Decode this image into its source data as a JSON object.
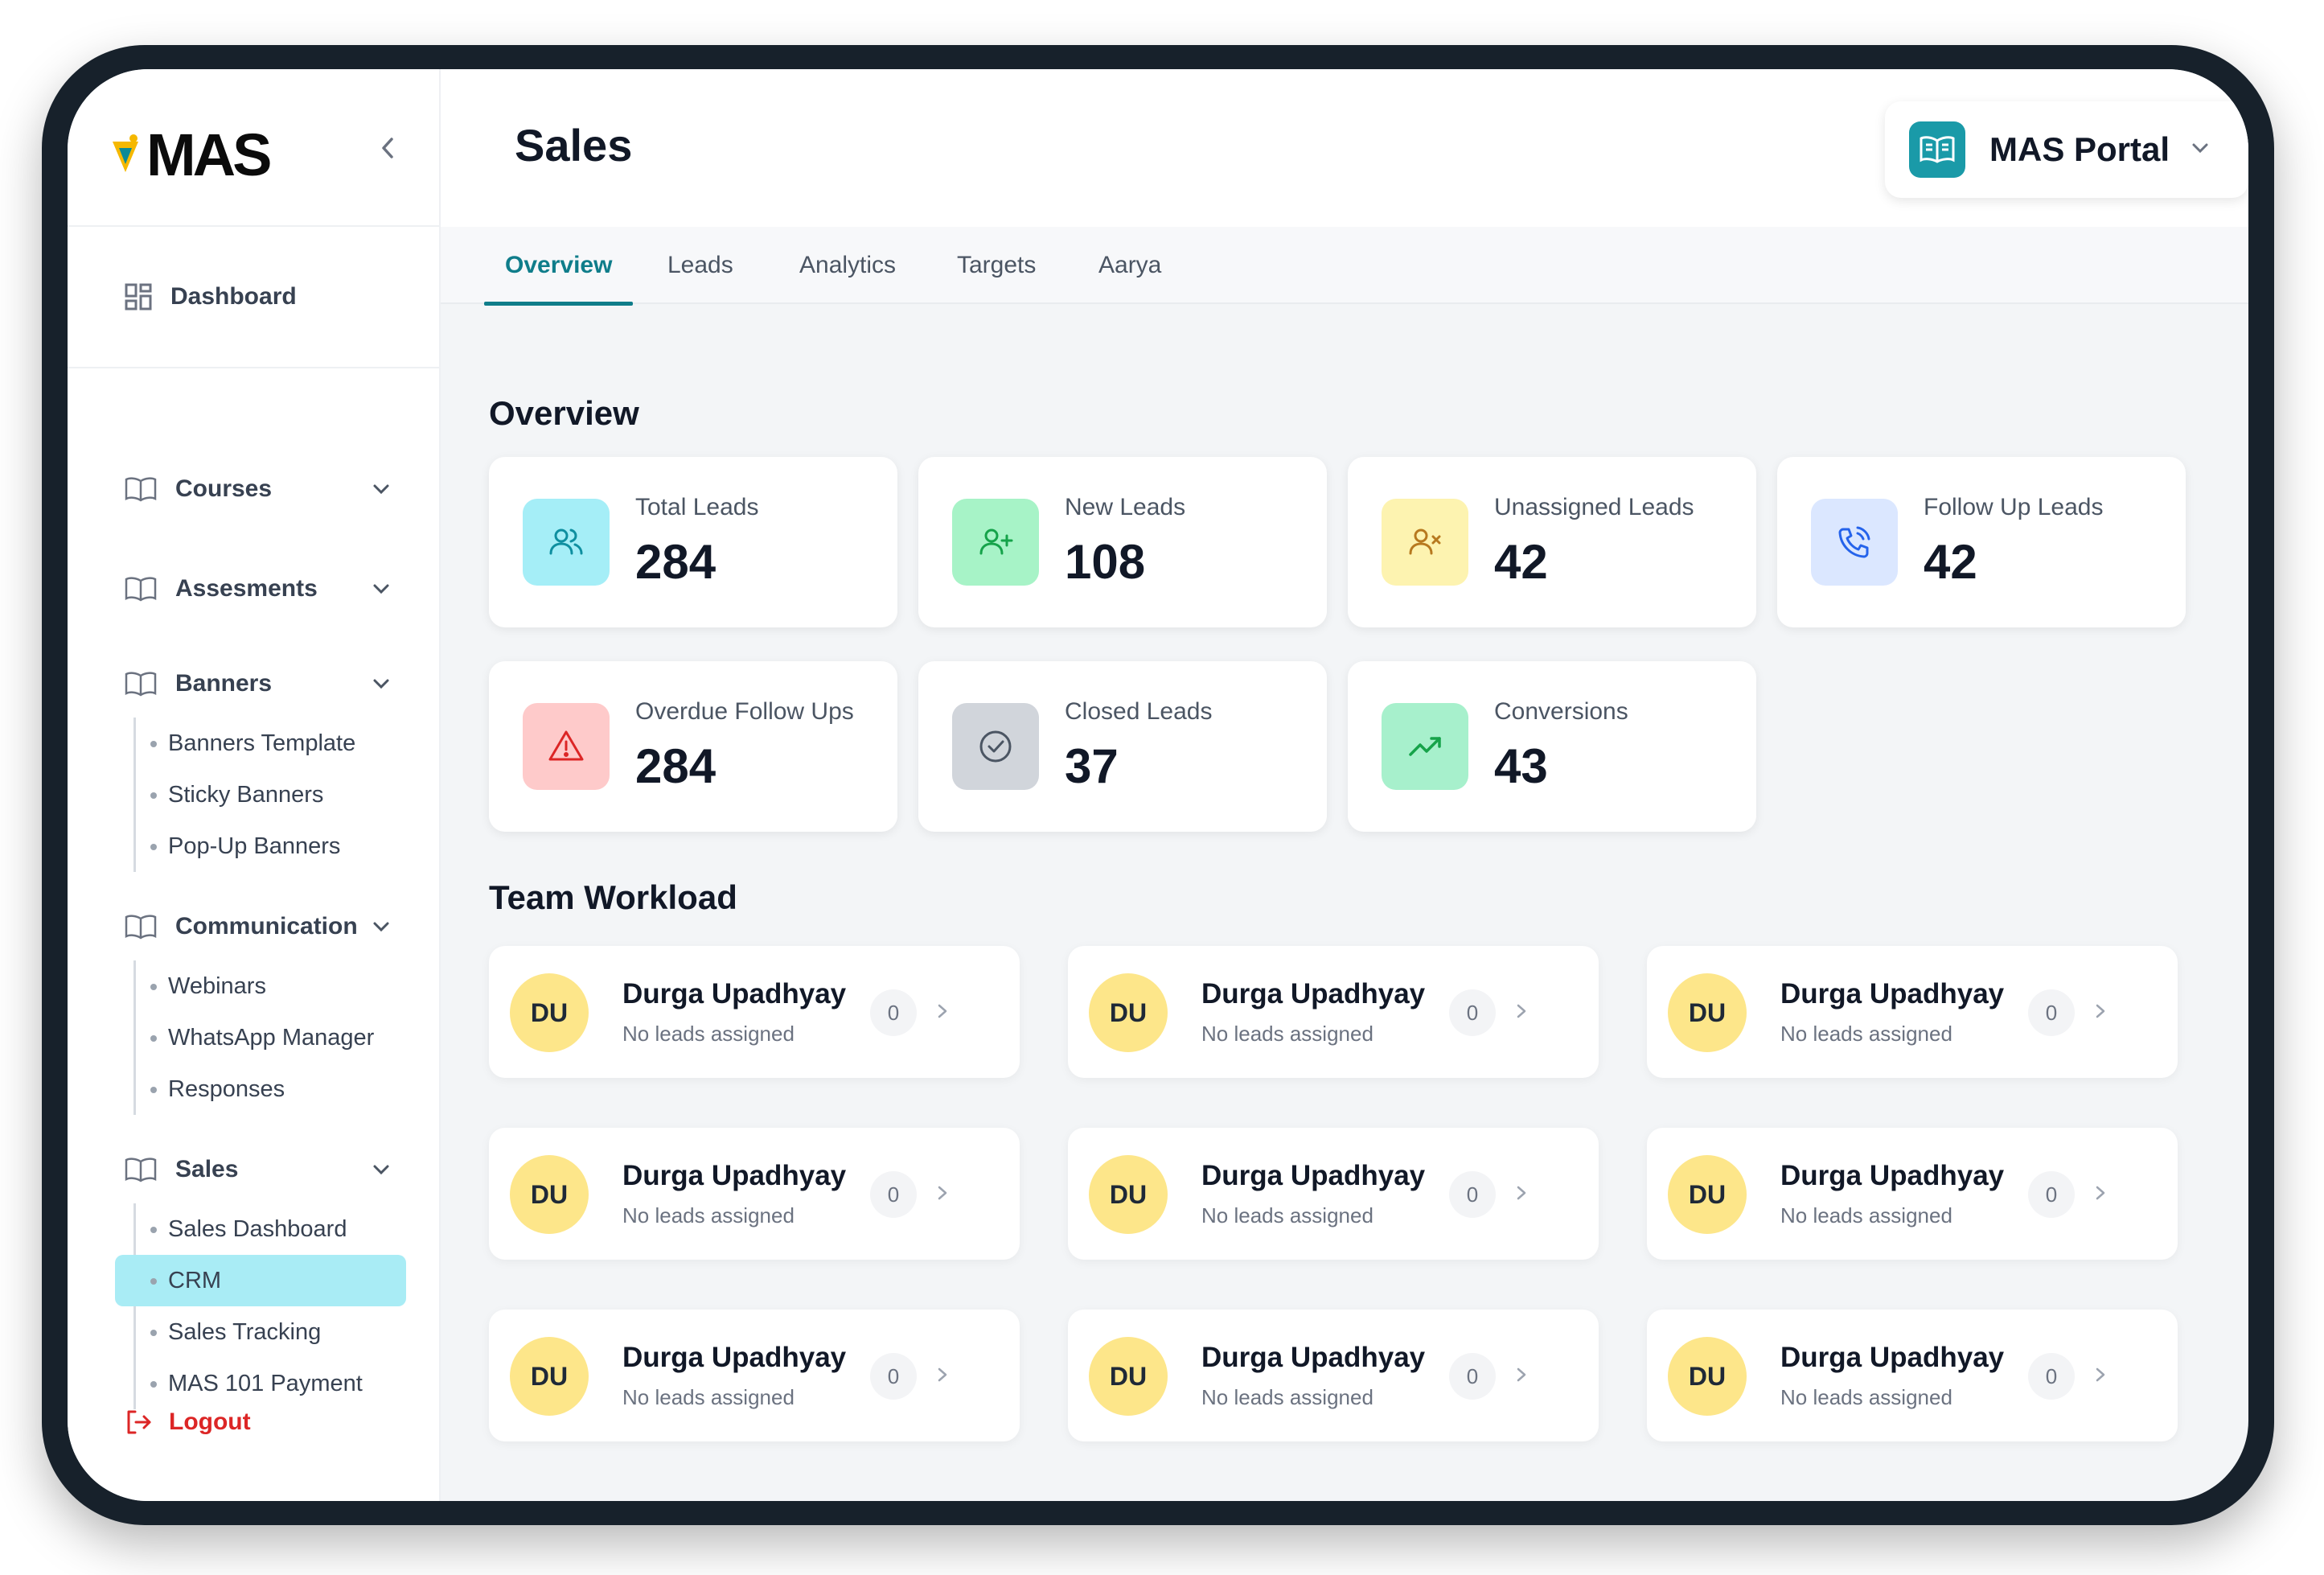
{
  "brand": {
    "logo_text": "MAS"
  },
  "header": {
    "title": "Sales",
    "portal_label": "MAS Portal"
  },
  "sidebar": {
    "dashboard": "Dashboard",
    "groups": [
      {
        "label": "Courses",
        "items": []
      },
      {
        "label": "Assesments",
        "items": []
      },
      {
        "label": "Banners",
        "items": [
          "Banners Template",
          "Sticky Banners",
          "Pop-Up Banners"
        ]
      },
      {
        "label": "Communication",
        "items": [
          "Webinars",
          "WhatsApp Manager",
          "Responses"
        ]
      },
      {
        "label": "Sales",
        "items": [
          "Sales Dashboard",
          "CRM",
          "Sales Tracking",
          "MAS 101 Payment"
        ]
      }
    ],
    "active_item": "CRM",
    "logout": "Logout"
  },
  "tabs": [
    {
      "label": "Overview",
      "active": true
    },
    {
      "label": "Leads",
      "active": false
    },
    {
      "label": "Analytics",
      "active": false
    },
    {
      "label": "Targets",
      "active": false
    },
    {
      "label": "Aarya",
      "active": false
    }
  ],
  "overview": {
    "title": "Overview",
    "stats": [
      {
        "label": "Total Leads",
        "value": "284",
        "icon": "users-icon",
        "bg": "#a5eef7",
        "color": "#0e8fa0"
      },
      {
        "label": "New Leads",
        "value": "108",
        "icon": "user-plus-icon",
        "bg": "#a7f3c7",
        "color": "#15a34a"
      },
      {
        "label": "Unassigned Leads",
        "value": "42",
        "icon": "user-x-icon",
        "bg": "#fdf3b0",
        "color": "#b7791f"
      },
      {
        "label": "Follow Up Leads",
        "value": "42",
        "icon": "phone-call-icon",
        "bg": "#dbe7ff",
        "color": "#2563eb"
      },
      {
        "label": "Overdue Follow Ups",
        "value": "284",
        "icon": "alert-triangle-icon",
        "bg": "#fecaca",
        "color": "#dc2626"
      },
      {
        "label": "Closed Leads",
        "value": "37",
        "icon": "check-circle-icon",
        "bg": "#d1d5db",
        "color": "#4b5563"
      },
      {
        "label": "Conversions",
        "value": "43",
        "icon": "trending-up-icon",
        "bg": "#a7f0cc",
        "color": "#16a34a"
      }
    ]
  },
  "team": {
    "title": "Team Workload",
    "members": [
      {
        "initials": "DU",
        "name": "Durga Upadhyay",
        "status": "No leads assigned",
        "count": "0"
      },
      {
        "initials": "DU",
        "name": "Durga Upadhyay",
        "status": "No leads assigned",
        "count": "0"
      },
      {
        "initials": "DU",
        "name": "Durga Upadhyay",
        "status": "No leads assigned",
        "count": "0"
      },
      {
        "initials": "DU",
        "name": "Durga Upadhyay",
        "status": "No leads assigned",
        "count": "0"
      },
      {
        "initials": "DU",
        "name": "Durga Upadhyay",
        "status": "No leads assigned",
        "count": "0"
      },
      {
        "initials": "DU",
        "name": "Durga Upadhyay",
        "status": "No leads assigned",
        "count": "0"
      },
      {
        "initials": "DU",
        "name": "Durga Upadhyay",
        "status": "No leads assigned",
        "count": "0"
      },
      {
        "initials": "DU",
        "name": "Durga Upadhyay",
        "status": "No leads assigned",
        "count": "0"
      },
      {
        "initials": "DU",
        "name": "Durga Upadhyay",
        "status": "No leads assigned",
        "count": "0"
      }
    ]
  },
  "colors": {
    "accent": "#0f7d8a",
    "active_bg": "#a9ecf5",
    "avatar_bg": "#fde68a",
    "logout": "#dc2626"
  }
}
